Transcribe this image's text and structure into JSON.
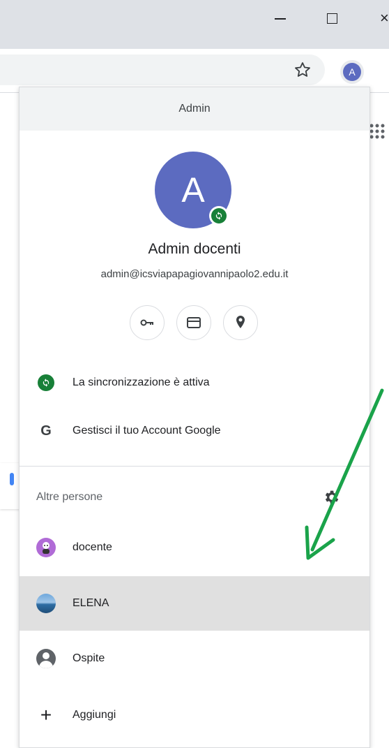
{
  "browser": {
    "minimize_icon": "minimize-icon",
    "maximize_icon": "maximize-icon",
    "close_glyph": "×",
    "profile_initial": "A"
  },
  "menu": {
    "header": "Admin",
    "avatar_initial": "A",
    "name": "Admin docenti",
    "email": "admin@icsviapapagiovannipaolo2.edu.it",
    "quick_actions": [
      "key-icon",
      "card-icon",
      "location-icon"
    ],
    "sync_label": "La sincronizzazione è attiva",
    "google_letter": "G",
    "manage_account_label": "Gestisci il tuo Account Google",
    "other_people_title": "Altre persone",
    "people": [
      {
        "name": "docente"
      },
      {
        "name": "ELENA",
        "highlighted": true
      }
    ],
    "guest_label": "Ospite",
    "add_glyph": "+",
    "add_label": "Aggiungi"
  },
  "colors": {
    "accent": "#5c6bc0",
    "sync_green": "#188038",
    "header_bg": "#f1f3f4",
    "highlight_row": "#e0e0e0",
    "annotation_arrow": "#1aa34a"
  }
}
